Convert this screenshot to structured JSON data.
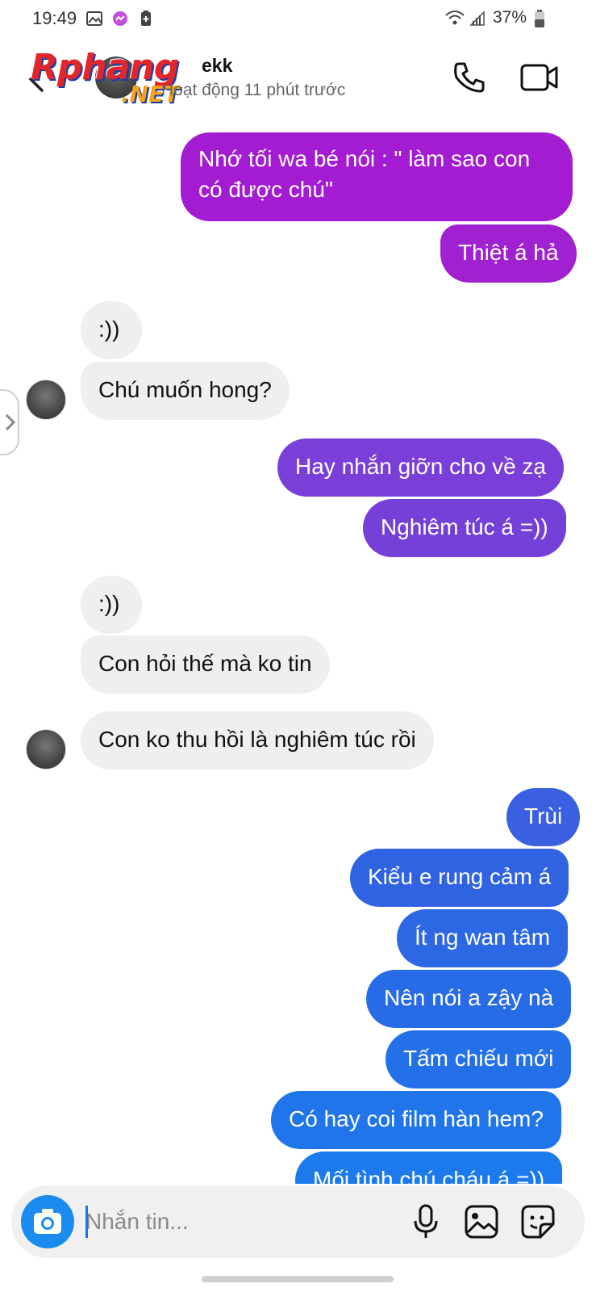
{
  "status_bar": {
    "time": "19:49",
    "battery": "37%",
    "icons_left": [
      "image-icon",
      "messenger-icon",
      "battery-saver-icon"
    ],
    "icons_right": [
      "wifi-icon",
      "signal-icon",
      "battery-icon"
    ]
  },
  "header": {
    "contact_name": "ekk",
    "status": "Hoạt động 11 phút trước",
    "watermark_main": "Rphang",
    "watermark_suffix": ".NET"
  },
  "colors": {
    "purple_top": "#a41fd0",
    "purple_mid": "#7e3cd6",
    "blue": "#2f6ae6",
    "incoming_bg": "#efefef",
    "accent": "#1a8cf0"
  },
  "messages": [
    {
      "id": "m1",
      "dir": "out",
      "text": "Nhớ tối wa bé nói : \" làm sao con",
      "text2": "có được chú\""
    },
    {
      "id": "m2",
      "dir": "out",
      "text": "Thiệt á hả"
    },
    {
      "id": "m3",
      "dir": "in",
      "text": ":))"
    },
    {
      "id": "m4",
      "dir": "in",
      "text": "Chú muốn hong?"
    },
    {
      "id": "m5",
      "dir": "out",
      "text": "Hay nhắn giỡn cho về zạ"
    },
    {
      "id": "m6",
      "dir": "out",
      "text": "Nghiêm túc á =))"
    },
    {
      "id": "m7",
      "dir": "in",
      "text": ":))"
    },
    {
      "id": "m8",
      "dir": "in",
      "text": "Con hỏi thế mà ko tin"
    },
    {
      "id": "m9",
      "dir": "in",
      "text": "Con ko thu hồi là nghiêm túc rồi"
    },
    {
      "id": "m10",
      "dir": "out",
      "text": "Trùi"
    },
    {
      "id": "m11",
      "dir": "out",
      "text": "Kiểu e rung cảm á"
    },
    {
      "id": "m12",
      "dir": "out",
      "text": "Ít ng wan tâm"
    },
    {
      "id": "m13",
      "dir": "out",
      "text": "Nên nói a zậy nà"
    },
    {
      "id": "m14",
      "dir": "out",
      "text": "Tấm chiếu mới"
    },
    {
      "id": "m15",
      "dir": "out",
      "text": "Có hay coi film hàn hem?"
    },
    {
      "id": "m16",
      "dir": "out",
      "text": "Mối tình chú cháu á =))"
    }
  ],
  "composer": {
    "placeholder": "Nhắn tin..."
  }
}
